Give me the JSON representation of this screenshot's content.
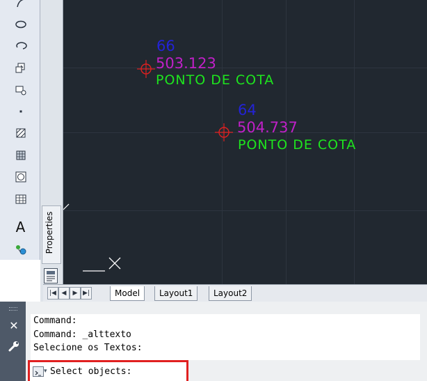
{
  "drawing": {
    "points": [
      {
        "number": "66",
        "elevation": "503.123",
        "label": "PONTO  DE  COTA"
      },
      {
        "number": "64",
        "elevation": "504.737",
        "label": "PONTO  DE  COTA"
      }
    ],
    "colors": {
      "background": "#212830",
      "number": "#2323d6",
      "elevation": "#c020c8",
      "label": "#1ee51e",
      "marker": "#e02020",
      "ucs": "#ffffff"
    }
  },
  "toolbar": {
    "icons": [
      "arc-icon",
      "ellipse-icon",
      "ellipse-arc-icon",
      "insert-block-icon",
      "make-block-icon",
      "point-icon",
      "hatch-icon",
      "gradient-icon",
      "region-icon",
      "table-icon",
      "multiline-text-icon",
      "add-selected-icon"
    ],
    "text_tool_glyph": "A"
  },
  "properties_palette": {
    "label": "Properties"
  },
  "layout_tabs": {
    "nav": [
      "first-layout-icon",
      "previous-layout-icon",
      "next-layout-icon",
      "last-layout-icon"
    ],
    "tabs": [
      {
        "label": "Model",
        "active": true
      },
      {
        "label": "Layout1",
        "active": false
      },
      {
        "label": "Layout2",
        "active": false
      }
    ]
  },
  "command_line": {
    "history": [
      "Command:",
      "Command: _alttexto",
      "Selecione os Textos:"
    ],
    "input_value": "Select objects:",
    "highlight_color": "#e02020"
  }
}
